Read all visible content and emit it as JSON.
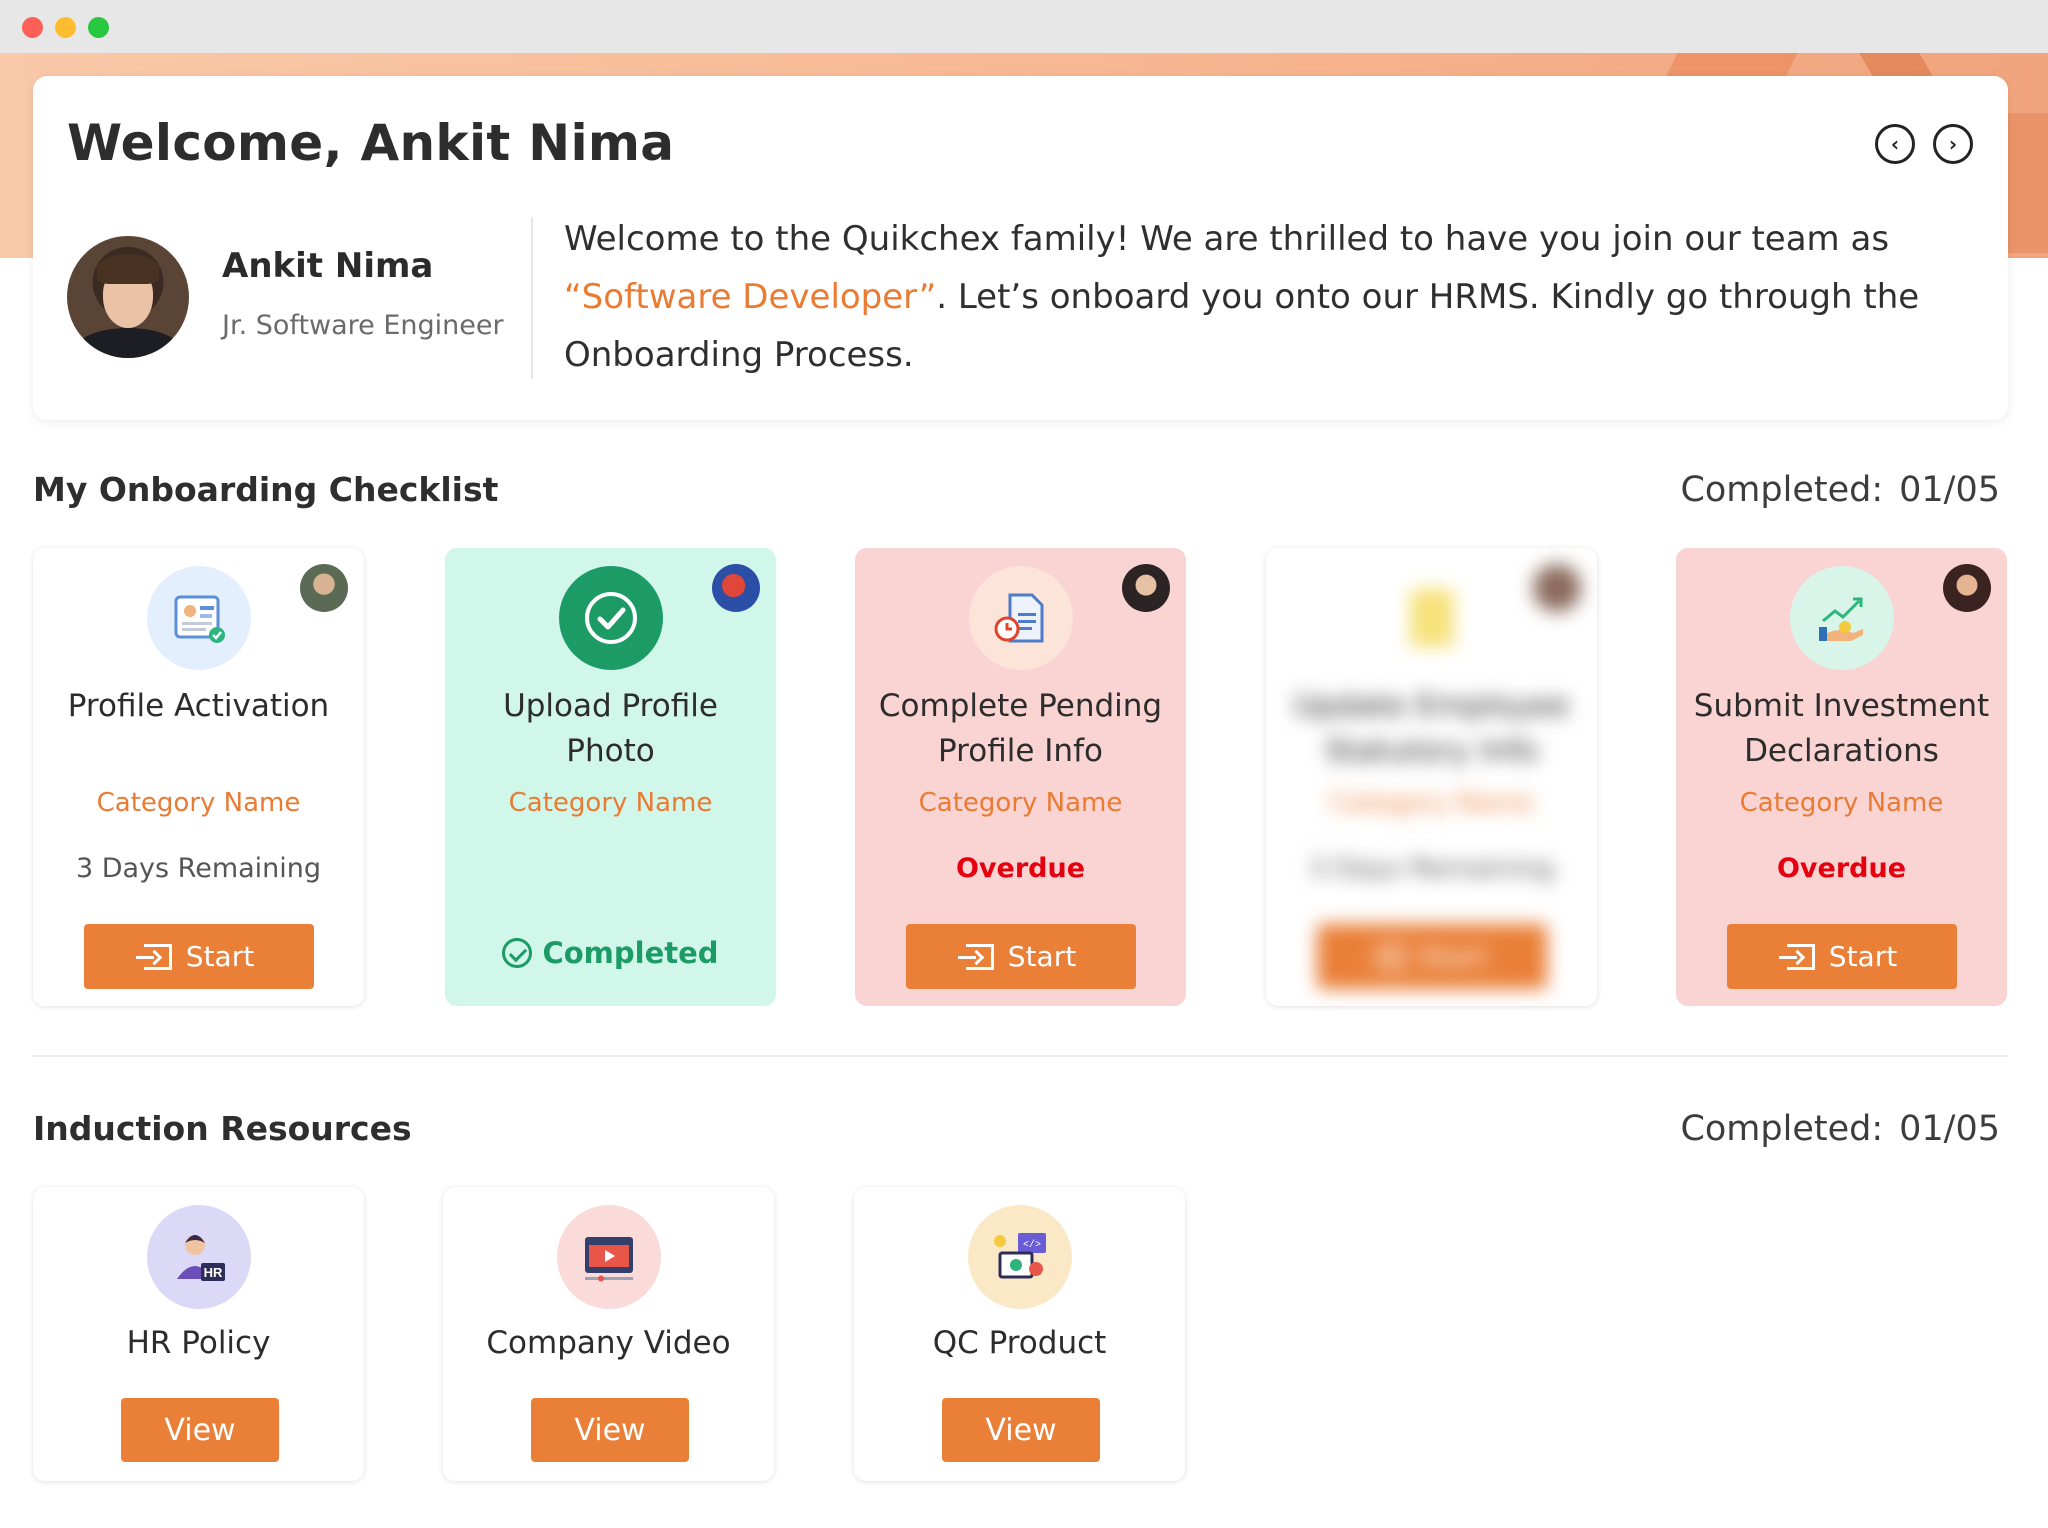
{
  "welcome": {
    "title": "Welcome, Ankit Nima",
    "user_name": "Ankit Nima",
    "user_role": "Jr. Software Engineer",
    "message_pre": "Welcome to the Quikchex family! We are thrilled to have you join our team as ",
    "message_role": "“Software Developer”",
    "message_post": ". Let’s onboard you onto our HRMS. Kindly go through the Onboarding Process."
  },
  "checklist": {
    "title": "My Onboarding Checklist",
    "completed_label": "Completed:",
    "completed_value": "01/05",
    "cards": [
      {
        "title": "Profile Activation",
        "category": "Category Name",
        "status": "3 Days Remaining",
        "button": "Start",
        "icon": "profile-card-icon"
      },
      {
        "title": "Upload Profile Photo",
        "category": "Category Name",
        "status": "Completed",
        "icon": "check-circle-icon"
      },
      {
        "title": "Complete Pending Profile Info",
        "category": "Category Name",
        "status": "Overdue",
        "button": "Start",
        "icon": "document-clock-icon"
      },
      {
        "title": "Update Employee Statutory Info",
        "category": "Category Name",
        "status": "3 Days Remaining",
        "button": "Start",
        "icon": "note-icon"
      },
      {
        "title": "Submit Investment Declarations",
        "category": "Category Name",
        "status": "Overdue",
        "button": "Start",
        "icon": "investment-growth-icon"
      }
    ]
  },
  "resources": {
    "title": "Induction Resources",
    "completed_label": "Completed:",
    "completed_value": "01/05",
    "cards": [
      {
        "title": "HR Policy",
        "button": "View",
        "icon": "hr-person-icon"
      },
      {
        "title": "Company Video",
        "button": "View",
        "icon": "video-player-icon"
      },
      {
        "title": "QC Product",
        "button": "View",
        "icon": "product-code-icon"
      }
    ]
  },
  "colors": {
    "accent": "#ea7f37",
    "overdue": "#e4000f",
    "completed": "#1d9b67",
    "completed_bg": "#d1f6ea",
    "overdue_bg": "#fad3d3"
  }
}
